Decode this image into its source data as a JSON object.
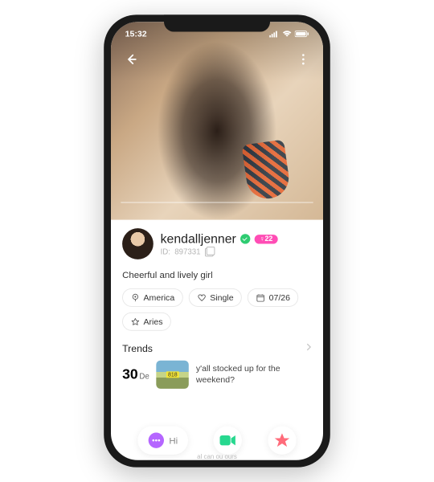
{
  "status": {
    "time": "15:32"
  },
  "profile": {
    "username": "kendalljenner",
    "gender_age": "♀22",
    "id_label": "ID:",
    "id_value": "897331",
    "bio": "Cheerful and lively girl"
  },
  "chips": {
    "location": "America",
    "status": "Single",
    "birthday": "07/26",
    "zodiac": "Aries"
  },
  "trends": {
    "title": "Trends",
    "day": "30",
    "month": "De",
    "text": "y'all stocked up for the weekend?"
  },
  "actions": {
    "hi_label": "Hi"
  },
  "faded": "al can ou ours"
}
